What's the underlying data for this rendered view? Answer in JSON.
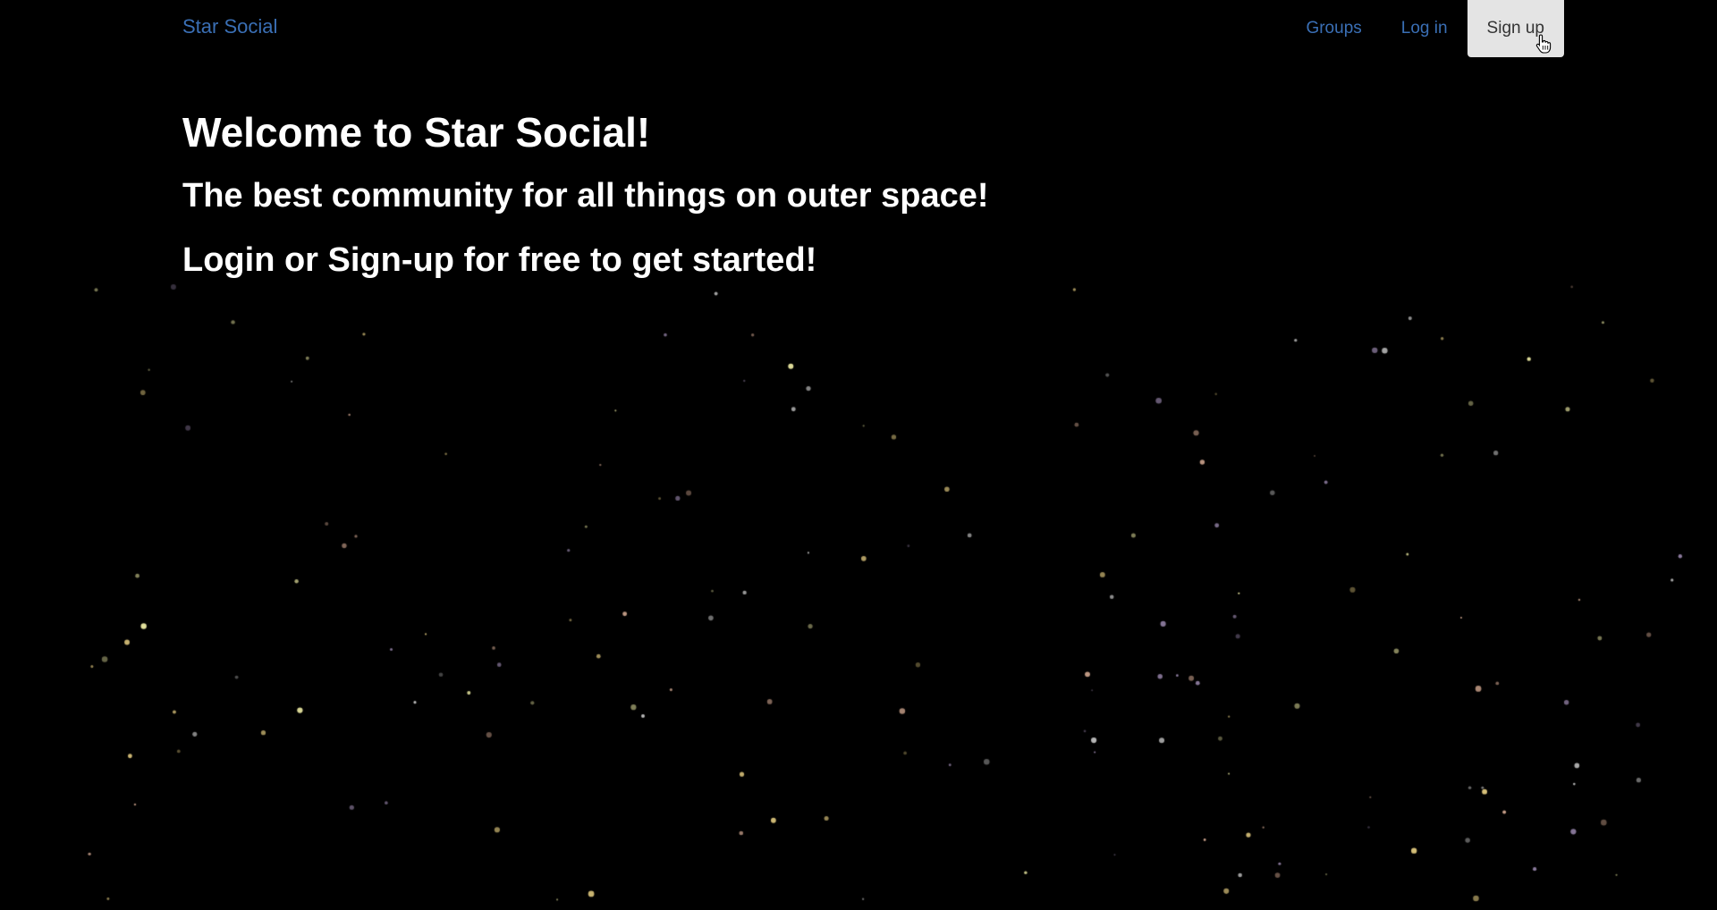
{
  "theme": {
    "background": "#000000",
    "link_color": "#3a6fb5",
    "text_color": "#ffffff",
    "active_bg": "#e4e4e4",
    "active_text": "#333333"
  },
  "navbar": {
    "brand": "Star Social",
    "links": [
      {
        "label": "Groups",
        "active": false
      },
      {
        "label": "Log in",
        "active": false
      },
      {
        "label": "Sign up",
        "active": true
      }
    ]
  },
  "hero": {
    "title": "Welcome to Star Social!",
    "subtitle": "The best community for all things on outer space!",
    "cta": "Login or Sign-up for free to get started!"
  },
  "background": {
    "type": "animated-starfield",
    "star_colors": [
      "#e8e6a0",
      "#c9a08a",
      "#b8b8b8",
      "#d9c27a",
      "#8c7b9e"
    ]
  }
}
